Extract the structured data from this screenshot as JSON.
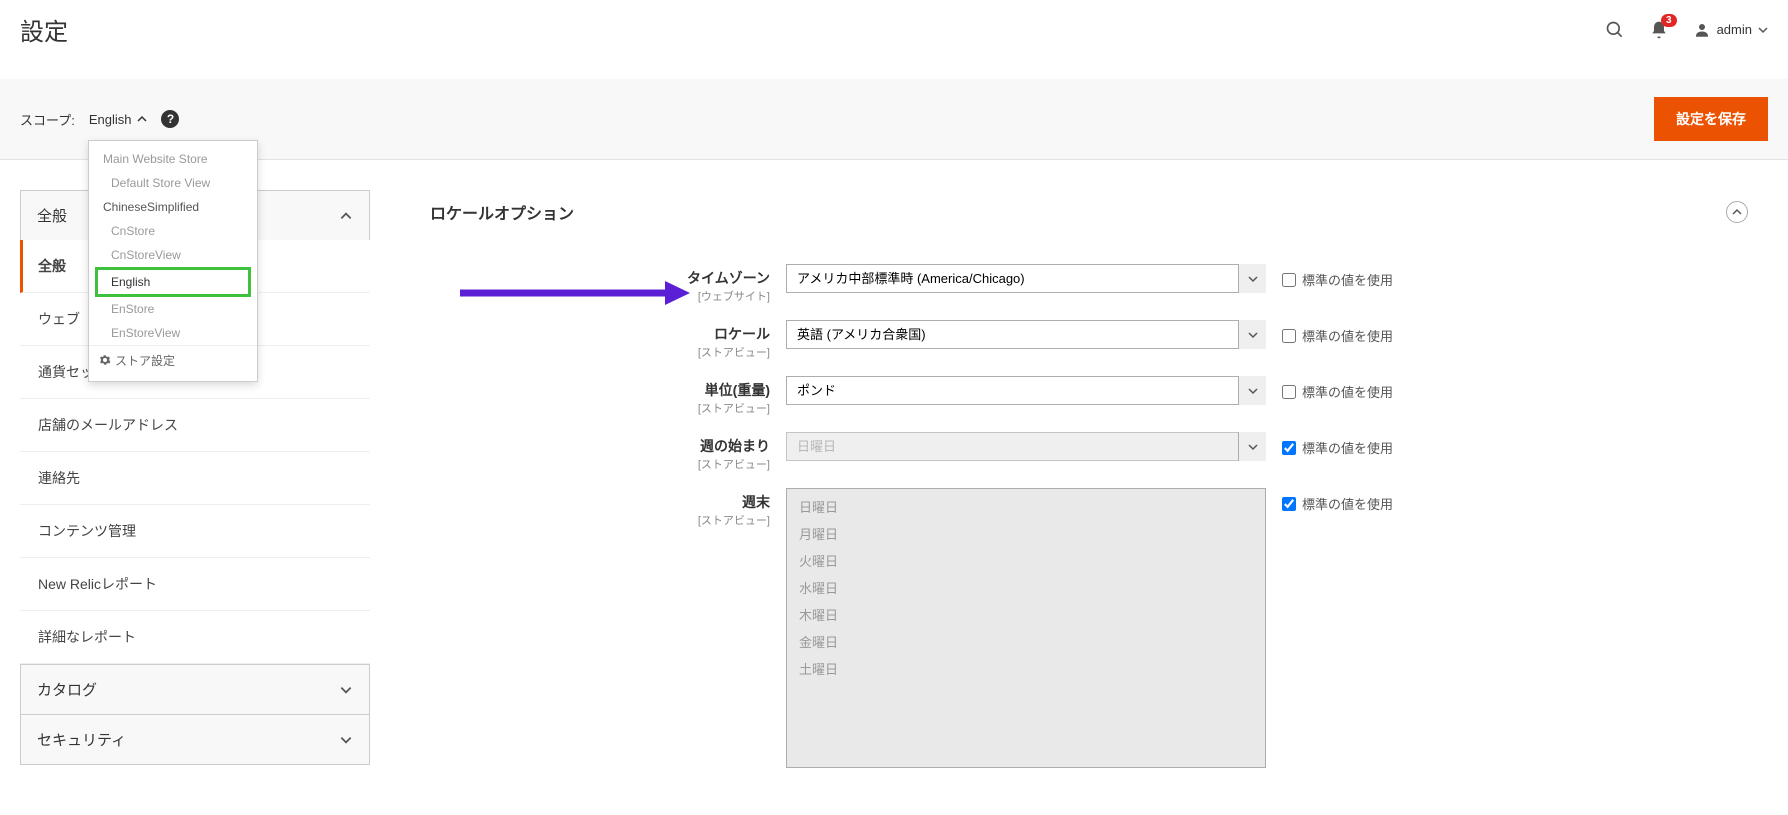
{
  "header": {
    "title": "設定",
    "notification_count": "3",
    "admin_label": "admin"
  },
  "toolbar": {
    "scope_label": "スコープ:",
    "scope_value": "English",
    "save_label": "設定を保存"
  },
  "scope_dropdown": {
    "items": [
      {
        "label": "Main Website Store",
        "level": 1
      },
      {
        "label": "Default Store View",
        "level": 2
      },
      {
        "label": "ChineseSimplified",
        "level": 0,
        "active": true
      },
      {
        "label": "CnStore",
        "level": 2
      },
      {
        "label": "CnStoreView",
        "level": 2
      },
      {
        "label": "English",
        "level": 0,
        "highlighted": true
      },
      {
        "label": "EnStore",
        "level": 2
      },
      {
        "label": "EnStoreView",
        "level": 2
      }
    ],
    "footer_label": "ストア設定"
  },
  "sidebar": {
    "sections": [
      {
        "label": "全般",
        "expanded": true
      },
      {
        "label": "カタログ",
        "expanded": false
      },
      {
        "label": "セキュリティ",
        "expanded": false
      }
    ],
    "items": [
      {
        "label": "全般",
        "active": true
      },
      {
        "label": "ウェブ"
      },
      {
        "label": "通貨セットアップ"
      },
      {
        "label": "店舗のメールアドレス"
      },
      {
        "label": "連絡先"
      },
      {
        "label": "コンテンツ管理"
      },
      {
        "label": "New Relicレポート"
      },
      {
        "label": "詳細なレポート"
      }
    ]
  },
  "main": {
    "section_title": "ロケールオプション",
    "use_default_label": "標準の値を使用",
    "fields": [
      {
        "label": "タイムゾーン",
        "sublabel": "[ウェブサイト]",
        "value": "アメリカ中部標準時 (America/Chicago)",
        "type": "select",
        "checked": false
      },
      {
        "label": "ロケール",
        "sublabel": "[ストアビュー]",
        "value": "英語 (アメリカ合衆国)",
        "type": "select",
        "checked": false
      },
      {
        "label": "単位(重量)",
        "sublabel": "[ストアビュー]",
        "value": "ポンド",
        "type": "select",
        "checked": false
      },
      {
        "label": "週の始まり",
        "sublabel": "[ストアビュー]",
        "value": "日曜日",
        "type": "select",
        "checked": true,
        "disabled": true
      },
      {
        "label": "週末",
        "sublabel": "[ストアビュー]",
        "type": "multiselect",
        "checked": true,
        "disabled": true
      }
    ],
    "weekend_options": [
      "日曜日",
      "月曜日",
      "火曜日",
      "水曜日",
      "木曜日",
      "金曜日",
      "土曜日"
    ]
  }
}
